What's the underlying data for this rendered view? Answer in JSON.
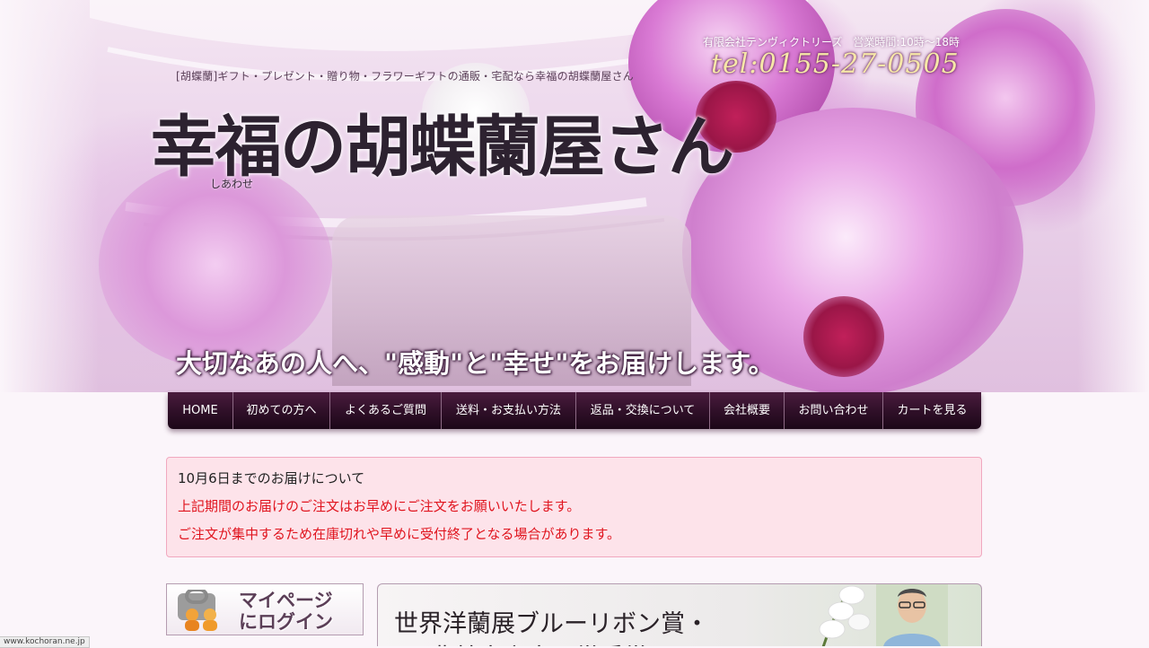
{
  "header": {
    "tagline": "[胡蝶蘭]ギフト・プレゼント・贈り物・フラワーギフトの通販・宅配なら幸福の胡蝶蘭屋さん",
    "company_hours": "有限会社テンヴィクトリーズ　営業時間:10時～18時",
    "tel": "tel:0155-27-0505",
    "logo_text": "幸福の胡蝶蘭屋さん",
    "logo_ruby": "しあわせ",
    "catchphrase": "大切なあの人へ、\"感動\"と\"幸せ\"をお届けします。"
  },
  "nav": {
    "items": [
      {
        "label": "HOME"
      },
      {
        "label": "初めての方へ"
      },
      {
        "label": "よくあるご質問"
      },
      {
        "label": "送料・お支払い方法"
      },
      {
        "label": "返品・交換について"
      },
      {
        "label": "会社概要"
      },
      {
        "label": "お問い合わせ"
      },
      {
        "label": "カートを見る"
      }
    ]
  },
  "notice": {
    "title": "10月6日までのお届けについて",
    "lines": [
      "上記期間のお届けのご注文はお早めにご注文をお願いいたします。",
      "ご注文が集中するため在庫切れや早めに受付終了となる場合があります。"
    ]
  },
  "mypage": {
    "line1": "マイページ",
    "line2": "にログイン"
  },
  "award": {
    "line1": "世界洋蘭展ブルーリボン賞・",
    "line2": "農林水産大臣賞受賞"
  },
  "status": {
    "url": "www.kochoran.ne.jp"
  },
  "colors": {
    "nav_bg": "#2e0f27",
    "notice_bg": "#fde3ea",
    "notice_border": "#f1a8bf",
    "notice_text": "#e0141e",
    "tel_text": "#f6e7a8"
  }
}
